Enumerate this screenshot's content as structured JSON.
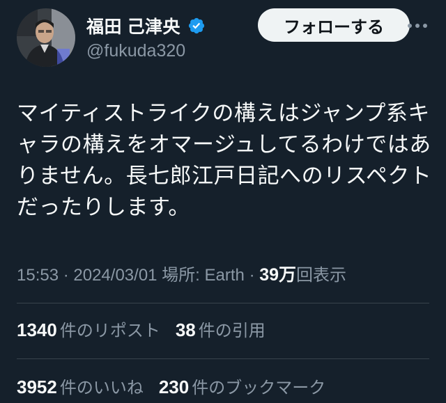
{
  "header": {
    "display_name": "福田 己津央",
    "handle": "@fukuda320",
    "follow_label": "フォローする",
    "more_label": "···"
  },
  "tweet": {
    "lines": [
      "マイティストライクの構えはジャンプ系キ",
      "ャラの構えをオマージュしてるわけではあ",
      "りません。長七郎江戸日記へのリスペクト",
      "だったりします。"
    ]
  },
  "meta": {
    "time": "15:53",
    "sep1": " · ",
    "date": "2024/03/01",
    "location_prefix": " 場所: ",
    "location": "Earth",
    "sep2": " · ",
    "views_count": "39万",
    "views_label": "回表示"
  },
  "stats": {
    "reposts_count": "1340",
    "reposts_label": "件のリポスト",
    "quotes_count": "38",
    "quotes_label": "件の引用",
    "likes_count": "3952",
    "likes_label": "件のいいね",
    "bookmarks_count": "230",
    "bookmarks_label": "件のブックマーク"
  },
  "colors": {
    "background": "#15202b",
    "text_primary": "#f7f9f9",
    "text_secondary": "#8b98a5",
    "verified_badge": "#1d9bf0",
    "divider": "#38444d",
    "follow_button_bg": "#eff3f4"
  },
  "icons": {
    "verified": "verified-badge-icon",
    "more": "more-dots-icon",
    "avatar": "profile-photo"
  }
}
